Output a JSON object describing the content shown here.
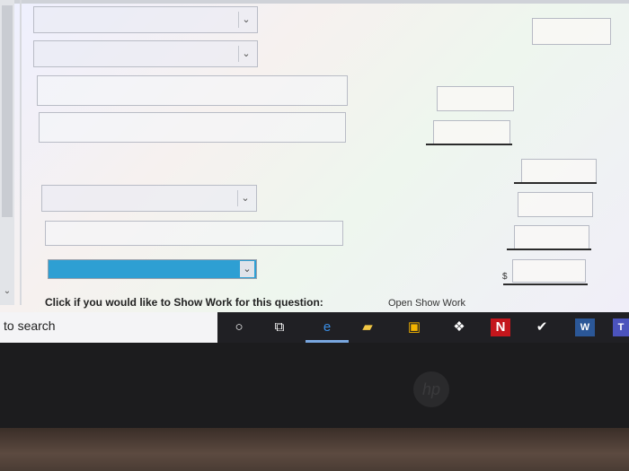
{
  "form": {
    "footer_text": "Click if you would like to Show Work for this question:",
    "footer_link": "Open Show Work",
    "currency_symbol": "$",
    "selects": [
      {
        "value": ""
      },
      {
        "value": ""
      },
      {
        "value": ""
      },
      {
        "value": ""
      }
    ],
    "highlighted_select": {
      "value": ""
    }
  },
  "taskbar": {
    "search_text": "to search",
    "apps": [
      "cortana-icon",
      "task-view-icon",
      "edge-icon",
      "file-explorer-icon",
      "store-icon",
      "dropbox-icon",
      "netflix-icon",
      "vpn-icon",
      "word-icon",
      "teams-icon"
    ],
    "netflix_label": "N",
    "word_label": "W",
    "teams_label": "T"
  },
  "colors": {
    "highlight": "#2e9fd3",
    "taskbar": "#202024",
    "netflix": "#c4161c",
    "word": "#2b5797",
    "teams": "#4b53bc"
  }
}
